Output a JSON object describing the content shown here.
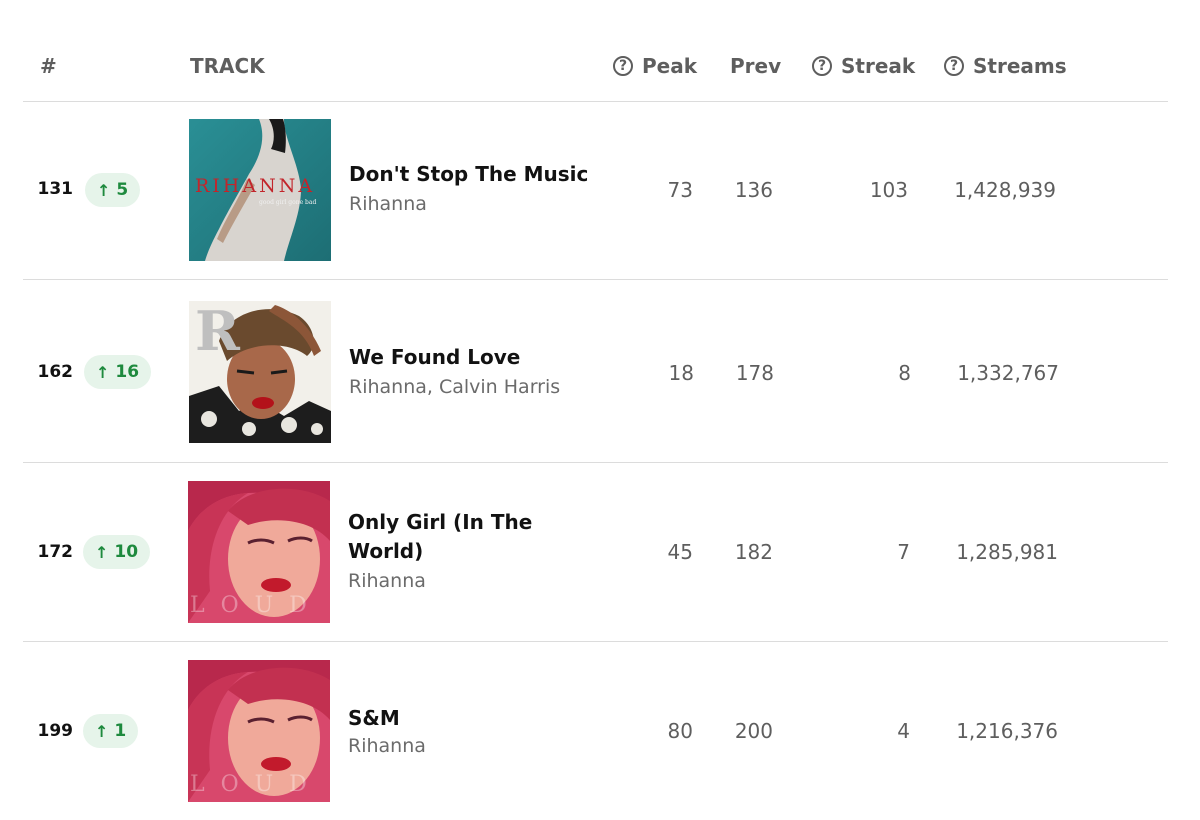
{
  "header": {
    "rank": "#",
    "track": "TRACK",
    "peak": "Peak",
    "prev": "Prev",
    "streak": "Streak",
    "streams": "Streams",
    "help_glyph": "?"
  },
  "rows": [
    {
      "rank": "131",
      "change": "5",
      "title": "Don't Stop The Music",
      "artist": "Rihanna",
      "peak": "73",
      "prev": "136",
      "streak": "103",
      "streams": "1,428,939",
      "cover_text": "RIHANNA",
      "cover_subtext": "good girl gone bad"
    },
    {
      "rank": "162",
      "change": "16",
      "title": "We Found Love",
      "artist": "Rihanna, Calvin Harris",
      "peak": "18",
      "prev": "178",
      "streak": "8",
      "streams": "1,332,767",
      "cover_text": "R"
    },
    {
      "rank": "172",
      "change": "10",
      "title": "Only Girl (In The World)",
      "artist": "Rihanna",
      "peak": "45",
      "prev": "182",
      "streak": "7",
      "streams": "1,285,981",
      "cover_text": "LOUD"
    },
    {
      "rank": "199",
      "change": "1",
      "title": "S&M",
      "artist": "Rihanna",
      "peak": "80",
      "prev": "200",
      "streak": "4",
      "streams": "1,216,376",
      "cover_text": "LOUD"
    }
  ],
  "colors": {
    "badge_bg": "#e6f4ea",
    "badge_text": "#1e8a3e",
    "muted": "#5e5e5e"
  },
  "icons": {
    "help": "question-circle-icon",
    "up": "arrow-up-icon"
  }
}
